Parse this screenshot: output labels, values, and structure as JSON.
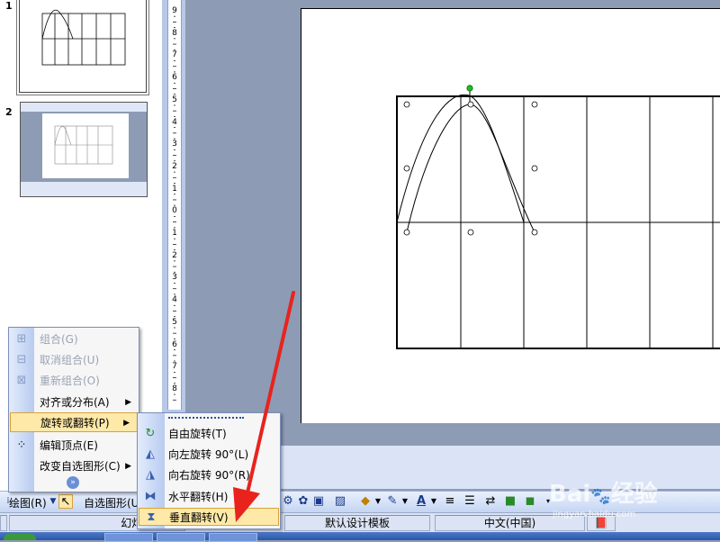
{
  "thumbnails": [
    {
      "number": "1",
      "selected": true
    },
    {
      "number": "2",
      "selected": false
    }
  ],
  "ruler": {
    "labels": [
      "9",
      "8",
      "7",
      "6",
      "5",
      "4",
      "3",
      "2",
      "1",
      "0",
      "1",
      "2",
      "3",
      "4",
      "5",
      "6",
      "7",
      "8",
      "9"
    ]
  },
  "context_menu": {
    "items": [
      {
        "label": "组合(G)",
        "enabled": false,
        "icon": "group-icon"
      },
      {
        "label": "取消组合(U)",
        "enabled": false,
        "icon": "ungroup-icon"
      },
      {
        "label": "重新组合(O)",
        "enabled": false,
        "icon": "regroup-icon"
      },
      {
        "label": "对齐或分布(A)",
        "enabled": true,
        "submenu": true
      },
      {
        "label": "旋转或翻转(P)",
        "enabled": true,
        "submenu": true,
        "highlighted": true
      },
      {
        "label": "编辑顶点(E)",
        "enabled": true,
        "icon": "edit-points-icon"
      },
      {
        "label": "改变自选图形(C)",
        "enabled": true,
        "submenu": true
      }
    ],
    "expand_icon": "double-chevron-down-icon"
  },
  "submenu": {
    "items": [
      {
        "label": "自由旋转(T)",
        "icon": "free-rotate-icon"
      },
      {
        "label": "向左旋转 90°(L)",
        "icon": "rotate-left-icon"
      },
      {
        "label": "向右旋转 90°(R)",
        "icon": "rotate-right-icon"
      },
      {
        "label": "水平翻转(H)",
        "icon": "flip-horizontal-icon"
      },
      {
        "label": "垂直翻转(V)",
        "icon": "flip-vertical-icon",
        "highlighted": true
      }
    ]
  },
  "drawing_toolbar": {
    "draw_label": "绘图(R)",
    "autoshapes_label": "自选图形(U)"
  },
  "statusbar": {
    "slide_info": "幻灯片 1 / 2",
    "template": "默认设计模板",
    "language": "中文(中国)"
  },
  "watermark": {
    "brand": "Bai",
    "brand2": "经验",
    "url": "jingyan.baidu.com"
  },
  "colors": {
    "menu_highlight": "#ffe9a8",
    "menu_highlight_border": "#d9a23a",
    "arrow_red": "#e8231d",
    "rotate_handle": "#22bb22"
  }
}
